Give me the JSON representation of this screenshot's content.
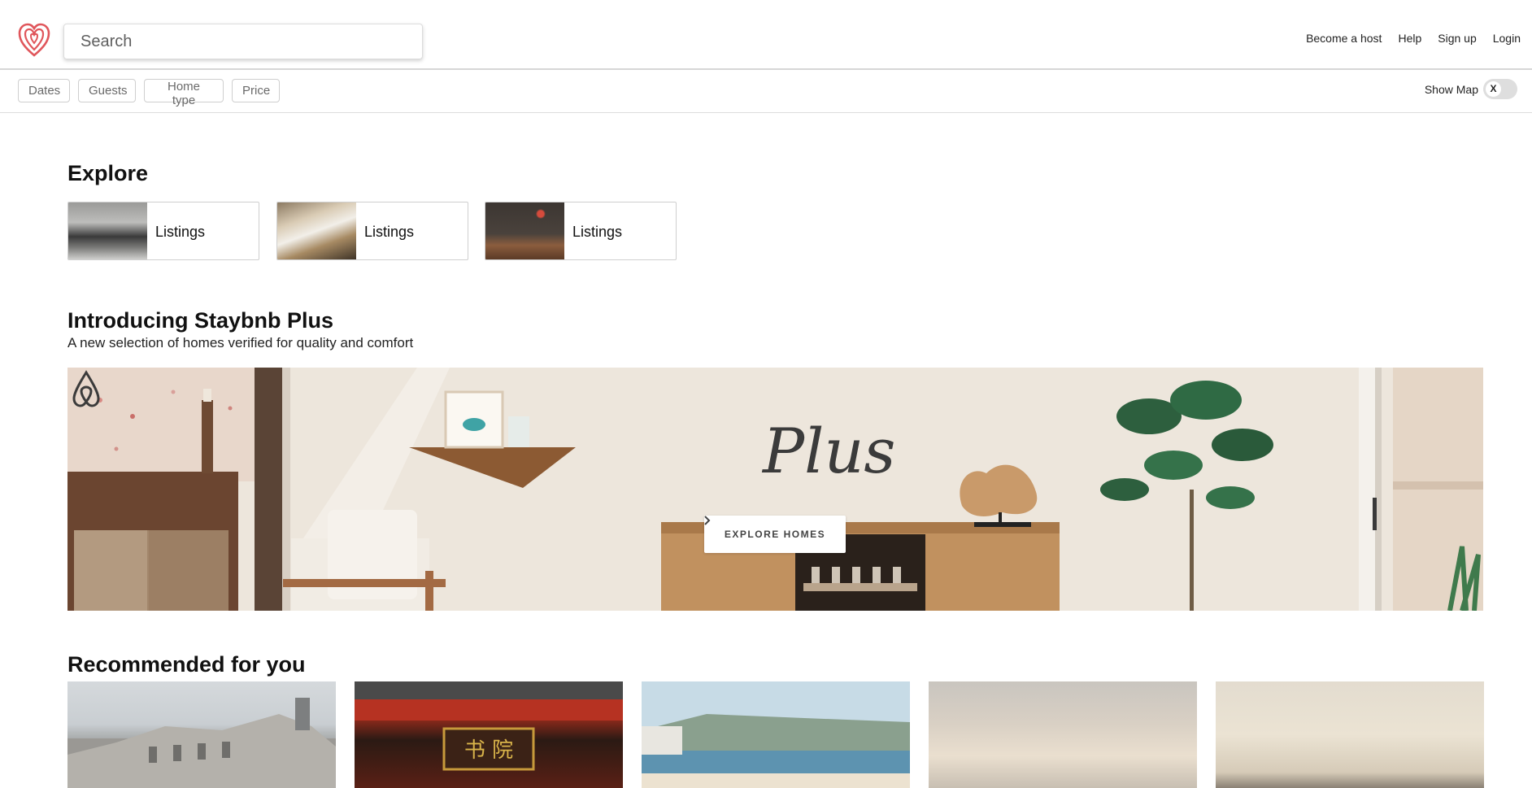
{
  "header": {
    "search_placeholder": "Search",
    "nav": [
      "Become a host",
      "Help",
      "Sign up",
      "Login"
    ]
  },
  "filters": [
    "Dates",
    "Guests",
    "Home type",
    "Price"
  ],
  "map_toggle": {
    "label": "Show Map",
    "state": "X"
  },
  "explore": {
    "title": "Explore",
    "cards": [
      {
        "label": "Listings",
        "image": "living-room-photo"
      },
      {
        "label": "Listings",
        "image": "dining-room-photo"
      },
      {
        "label": "Listings",
        "image": "lounge-photo"
      }
    ]
  },
  "plus": {
    "title": "Introducing Staybnb Plus",
    "subtitle": "A new selection of homes verified for quality and comfort",
    "logo_text": "Plus",
    "button": "EXPLORE HOMES",
    "button_icon": "chevron-right-icon"
  },
  "recommended": {
    "title": "Recommended for you",
    "cards": [
      {
        "image": "historic-building-photo"
      },
      {
        "image": "red-gate-photo"
      },
      {
        "image": "beach-town-photo"
      },
      {
        "image": "cloudy-sky-photo"
      },
      {
        "image": "hazy-landscape-photo"
      }
    ]
  },
  "colors": {
    "brand": "#e0565b",
    "toggle_bg": "#dedede"
  }
}
